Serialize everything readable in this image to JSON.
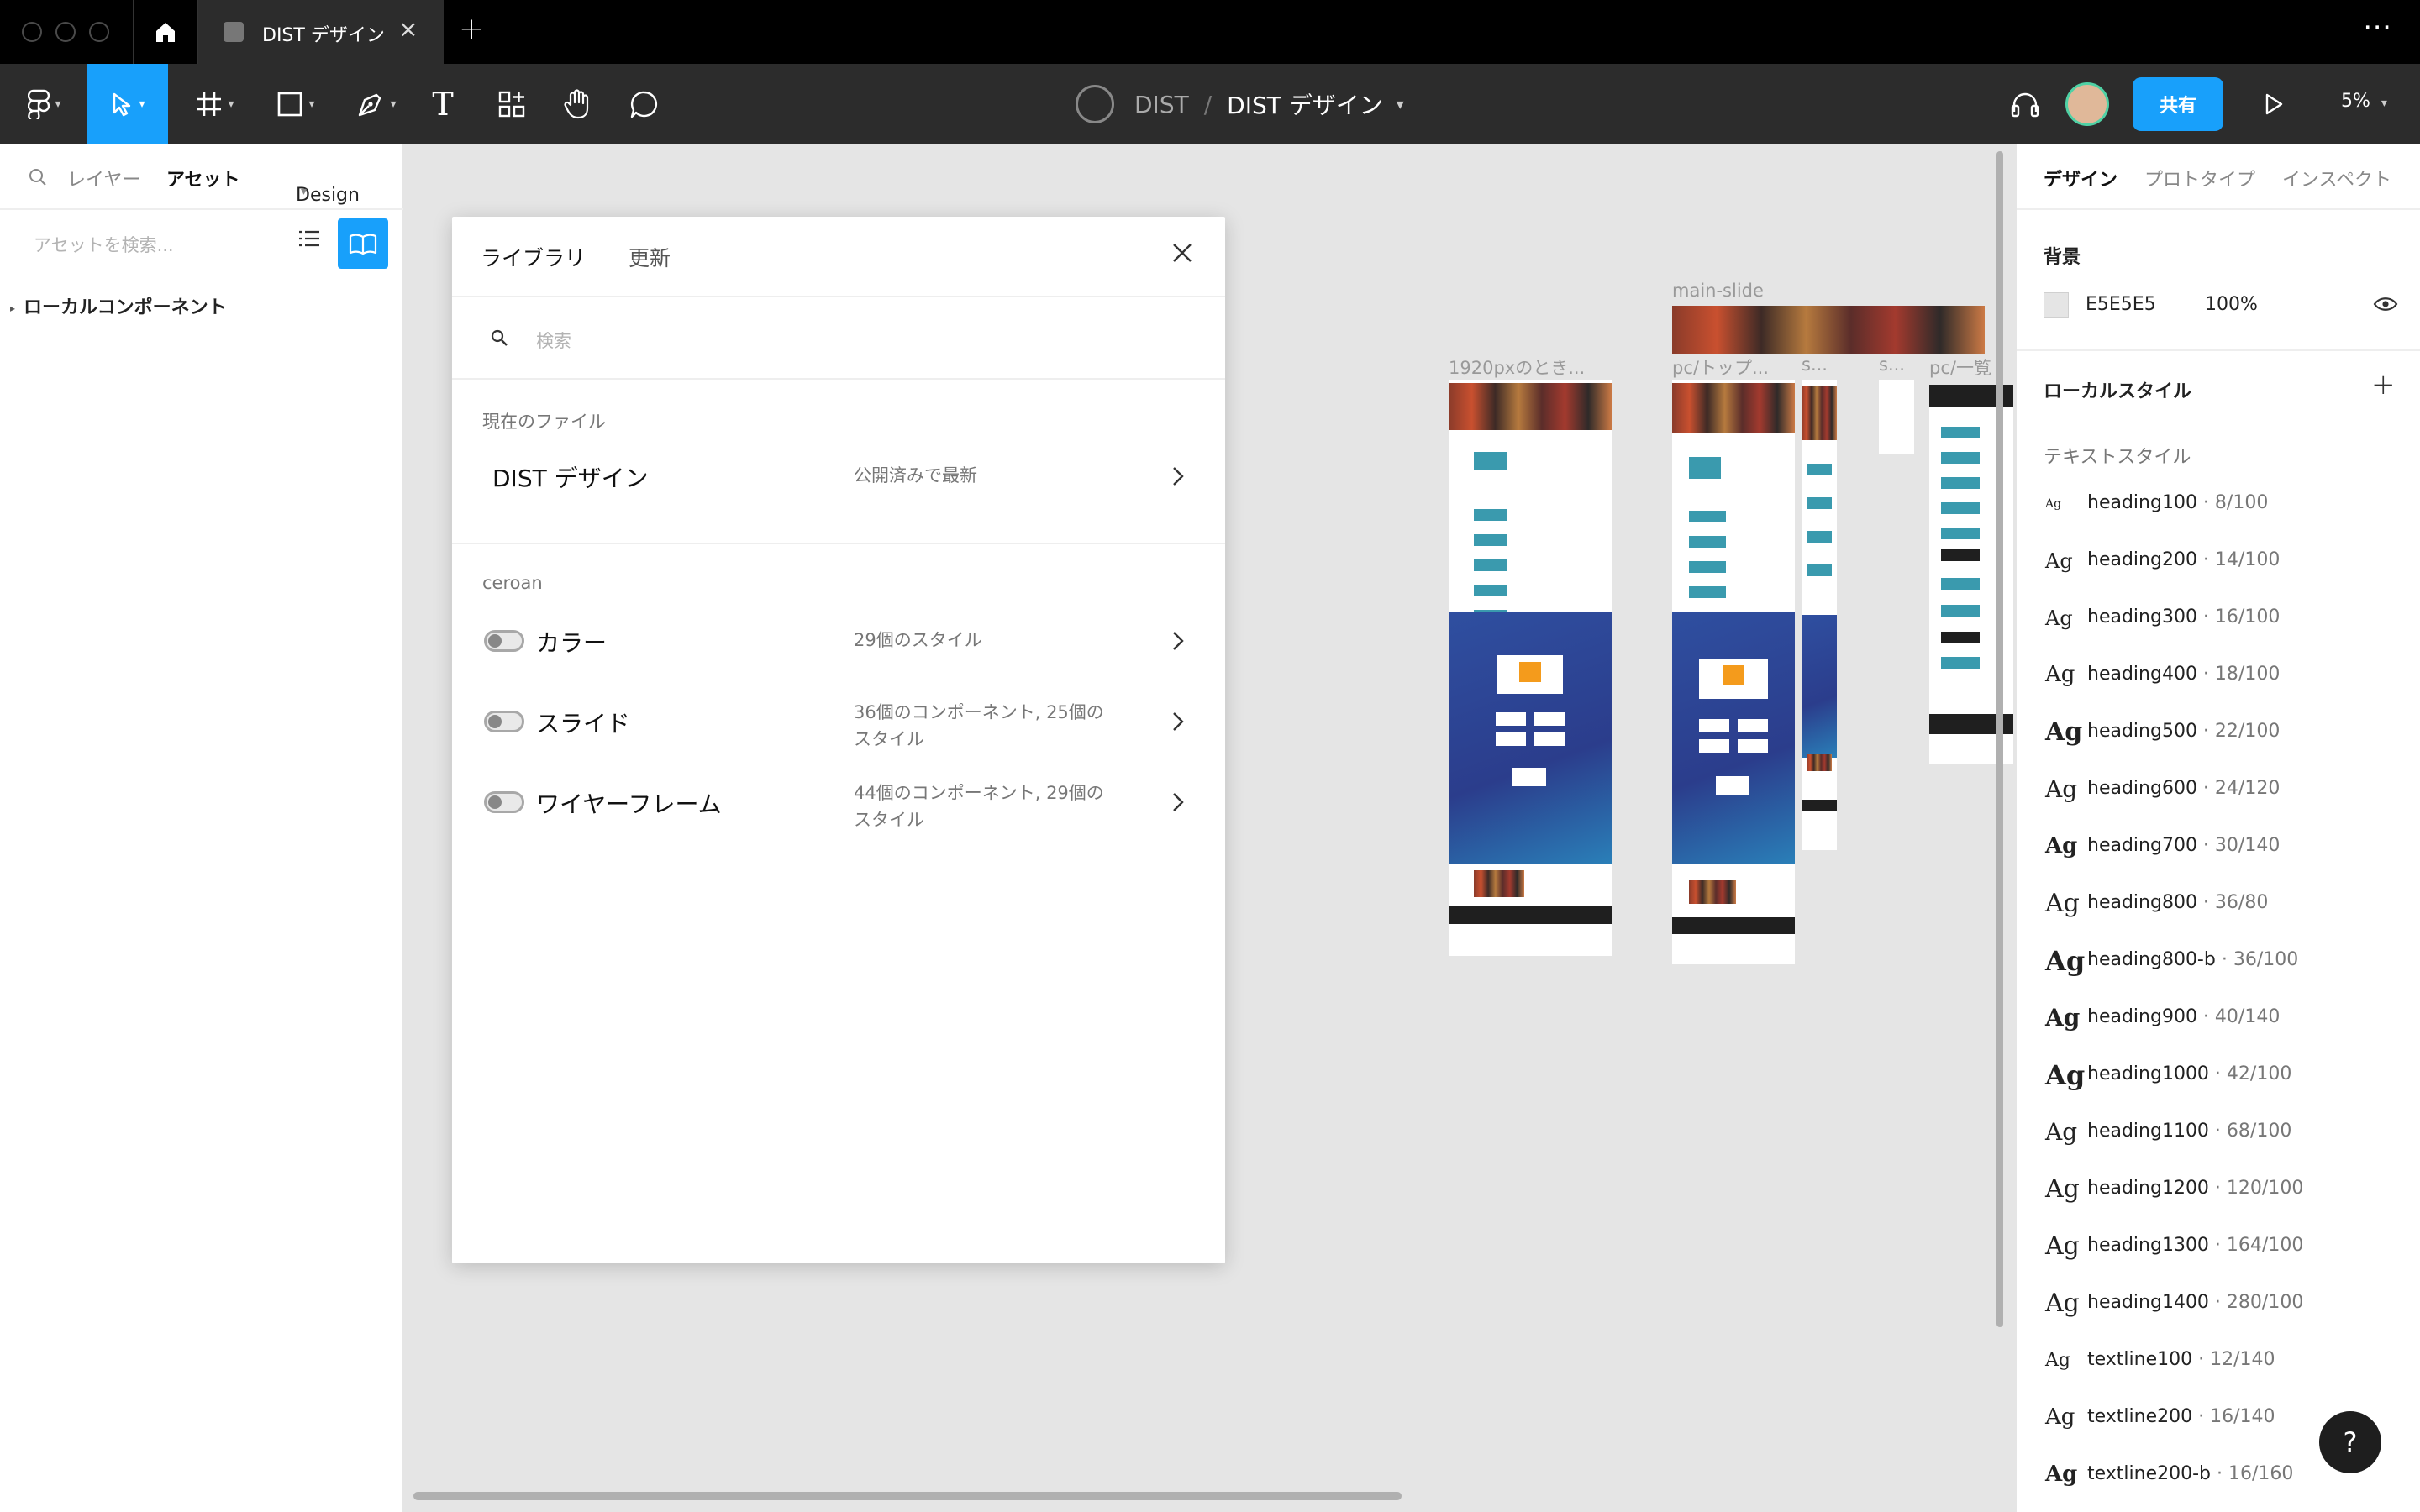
{
  "titlebar": {
    "tab_title": "DIST デザイン",
    "close_glyph": "×",
    "new_tab_glyph": "+",
    "more_glyph": "⋯"
  },
  "toolbar": {
    "project": "DIST",
    "separator": "/",
    "file_title": "DIST デザイン",
    "share_label": "共有",
    "zoom_label": "5%",
    "text_tool_glyph": "T"
  },
  "left_panel": {
    "tabs": {
      "layers": "レイヤー",
      "assets": "アセット",
      "page": "Design"
    },
    "search_placeholder": "アセットを検索...",
    "local_components": "ローカルコンポーネント"
  },
  "library_modal": {
    "tab_library": "ライブラリ",
    "tab_updates": "更新",
    "search_placeholder": "検索",
    "current_file_label": "現在のファイル",
    "current_file": {
      "name": "DIST デザイン",
      "status": "公開済みで最新"
    },
    "team_label": "ceroan",
    "libraries": [
      {
        "name": "カラー",
        "desc": "29個のスタイル",
        "enabled": false
      },
      {
        "name": "スライド",
        "desc": "36個のコンポーネント, 25個のスタイル",
        "enabled": false
      },
      {
        "name": "ワイヤーフレーム",
        "desc": "44個のコンポーネント, 29個のスタイル",
        "enabled": false
      }
    ]
  },
  "canvas": {
    "background": "#e5e5e5",
    "frames": {
      "main_slide": "main-slide",
      "f1920": "1920pxのとき...",
      "pc_top": "pc/トップ...",
      "s1": "s...",
      "s2": "s...",
      "pc_list": "pc/一覧"
    }
  },
  "right_panel": {
    "tabs": {
      "design": "デザイン",
      "prototype": "プロトタイプ",
      "inspect": "インスペクト"
    },
    "background_title": "背景",
    "background_hex": "E5E5E5",
    "background_opacity": "100%",
    "local_styles_title": "ローカルスタイル",
    "add_glyph": "+",
    "text_styles_label": "テキストスタイル",
    "text_styles": [
      {
        "name": "heading100",
        "meta": " · 8/100"
      },
      {
        "name": "heading200",
        "meta": " · 14/100"
      },
      {
        "name": "heading300",
        "meta": " · 16/100"
      },
      {
        "name": "heading400",
        "meta": " · 18/100"
      },
      {
        "name": "heading500",
        "meta": " · 22/100"
      },
      {
        "name": "heading600",
        "meta": " · 24/120"
      },
      {
        "name": "heading700",
        "meta": " · 30/140"
      },
      {
        "name": "heading800",
        "meta": " · 36/80"
      },
      {
        "name": "heading800-b",
        "meta": " · 36/100"
      },
      {
        "name": "heading900",
        "meta": " · 40/140"
      },
      {
        "name": "heading1000",
        "meta": " · 42/100"
      },
      {
        "name": "heading1100",
        "meta": " · 68/100"
      },
      {
        "name": "heading1200",
        "meta": " · 120/100"
      },
      {
        "name": "heading1300",
        "meta": " · 164/100"
      },
      {
        "name": "heading1400",
        "meta": " · 280/100"
      },
      {
        "name": "textline100",
        "meta": " · 12/140"
      },
      {
        "name": "textline200",
        "meta": " · 16/140"
      },
      {
        "name": "textline200-b",
        "meta": " · 16/160"
      }
    ],
    "style_preview": "Ag",
    "help_glyph": "?"
  },
  "colors": {
    "accent": "#18a0fb",
    "toolbar": "#2c2c2c",
    "titlebar": "#000000"
  }
}
